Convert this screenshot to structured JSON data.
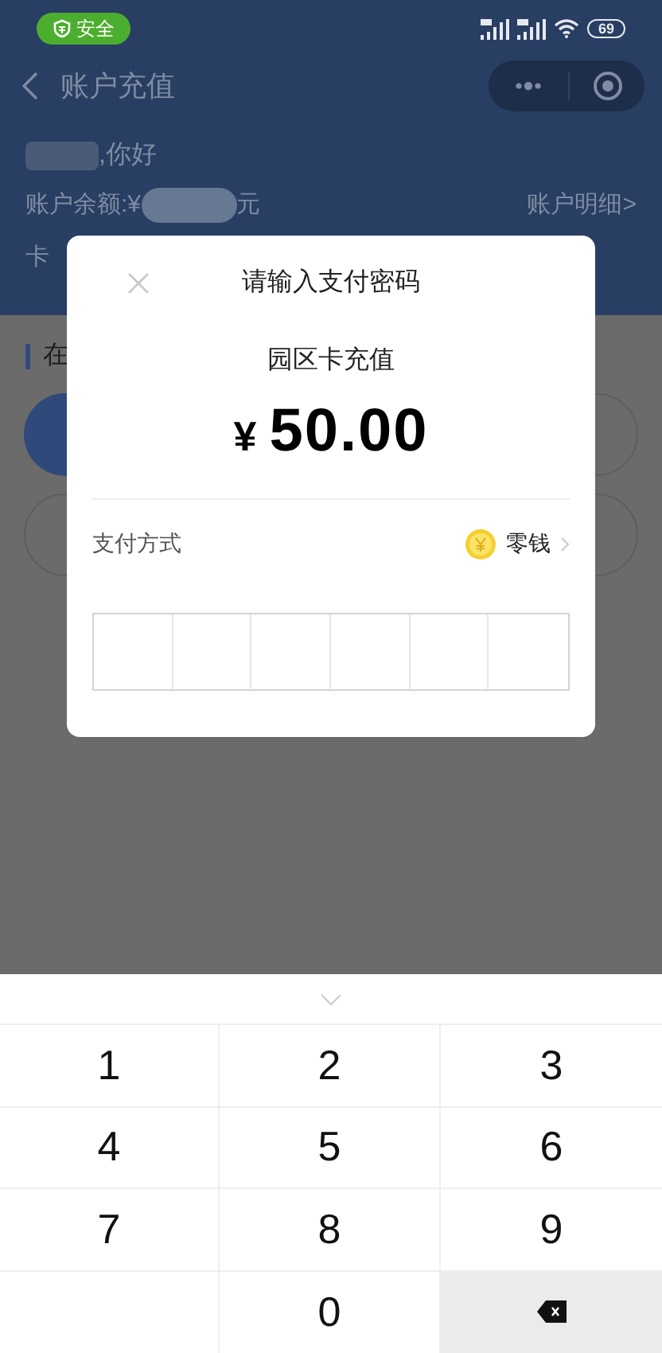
{
  "status_bar": {
    "security_badge": "安全",
    "battery": "69"
  },
  "header": {
    "title": "账户充值"
  },
  "account": {
    "greeting": ",你好",
    "balance_label": "账户余额:¥",
    "balance_unit": "元",
    "details_link": "账户明细>",
    "card_label": "卡"
  },
  "section": {
    "title": "在"
  },
  "dialog": {
    "title": "请输入支付密码",
    "item": "园区卡充值",
    "currency": "¥",
    "amount": "50.00",
    "payment_label": "支付方式",
    "payment_method": "零钱"
  },
  "keypad": {
    "keys": [
      {
        "kind": "digit",
        "label": "1"
      },
      {
        "kind": "digit",
        "label": "2"
      },
      {
        "kind": "digit",
        "label": "3"
      },
      {
        "kind": "digit",
        "label": "4"
      },
      {
        "kind": "digit",
        "label": "5"
      },
      {
        "kind": "digit",
        "label": "6"
      },
      {
        "kind": "digit",
        "label": "7"
      },
      {
        "kind": "digit",
        "label": "8"
      },
      {
        "kind": "digit",
        "label": "9"
      },
      {
        "kind": "blank"
      },
      {
        "kind": "digit",
        "label": "0"
      },
      {
        "kind": "backspace"
      }
    ]
  }
}
